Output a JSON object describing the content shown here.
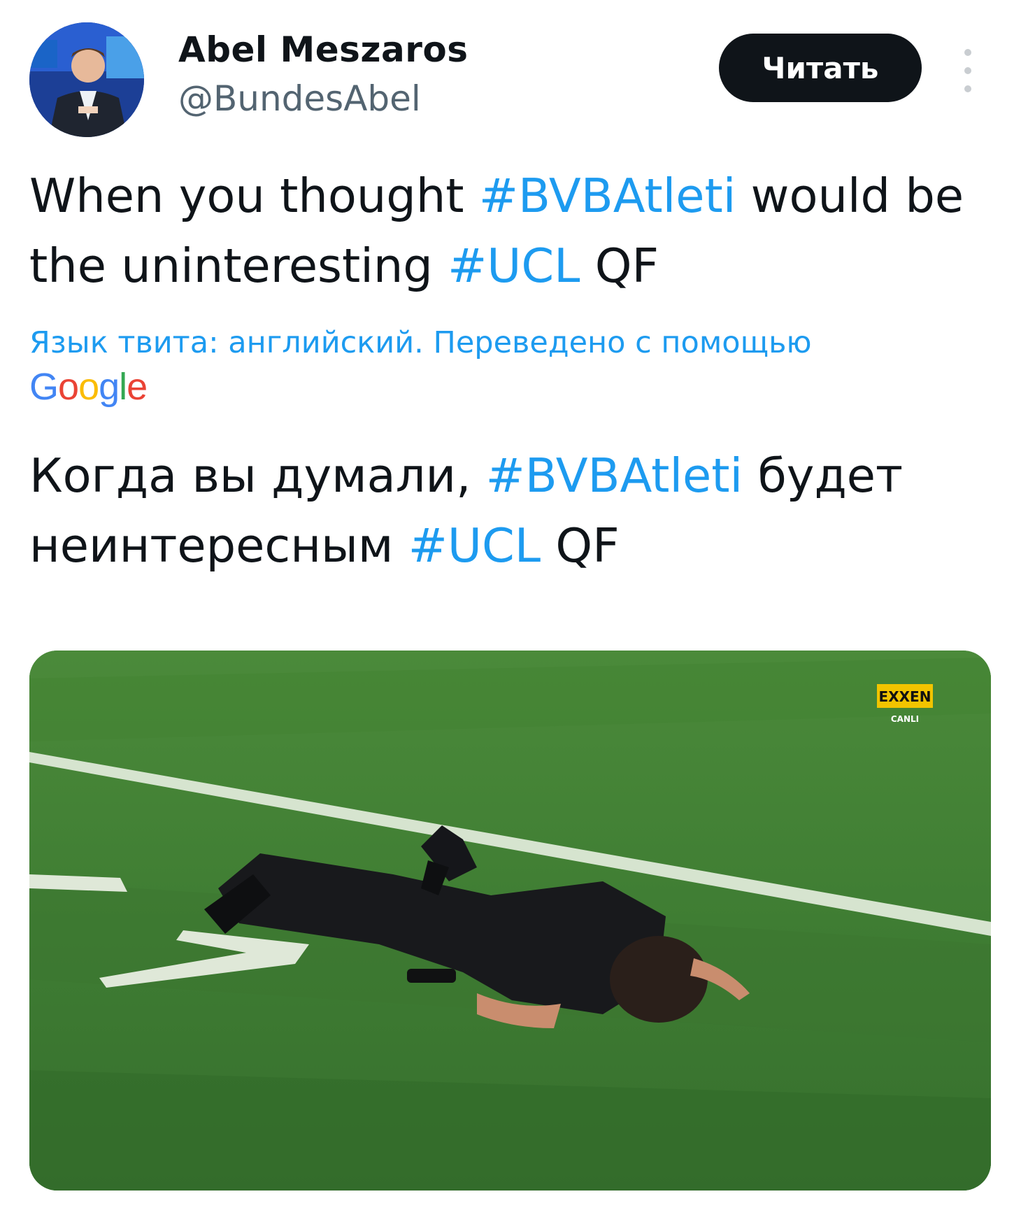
{
  "user": {
    "name": "Abel Meszaros",
    "handle": "@BundesAbel"
  },
  "follow_button": {
    "label": "Читать"
  },
  "tweet": {
    "en": {
      "part1": "When you thought ",
      "hashtag1": "#BVBAtleti",
      "part2": " would be the uninteresting ",
      "hashtag2": "#UCL",
      "part3": " QF"
    },
    "translation_note": "Язык твита: английский. Переведено с помощью",
    "translation_provider": {
      "letters": [
        "G",
        "o",
        "o",
        "g",
        "l",
        "e"
      ]
    },
    "ru": {
      "part1": "Когда вы думали, ",
      "hashtag1": "#BVBAtleti",
      "part2": " будет неинтересным ",
      "hashtag2": "#UCL",
      "part3": " QF"
    }
  },
  "media": {
    "watermark": "EXXEN",
    "watermark_sub": "CANLI"
  },
  "colors": {
    "accent": "#1d9bf0",
    "button_bg": "#0f1419",
    "text": "#0f1419",
    "muted": "#536471",
    "pitch": "#3d7a32"
  }
}
